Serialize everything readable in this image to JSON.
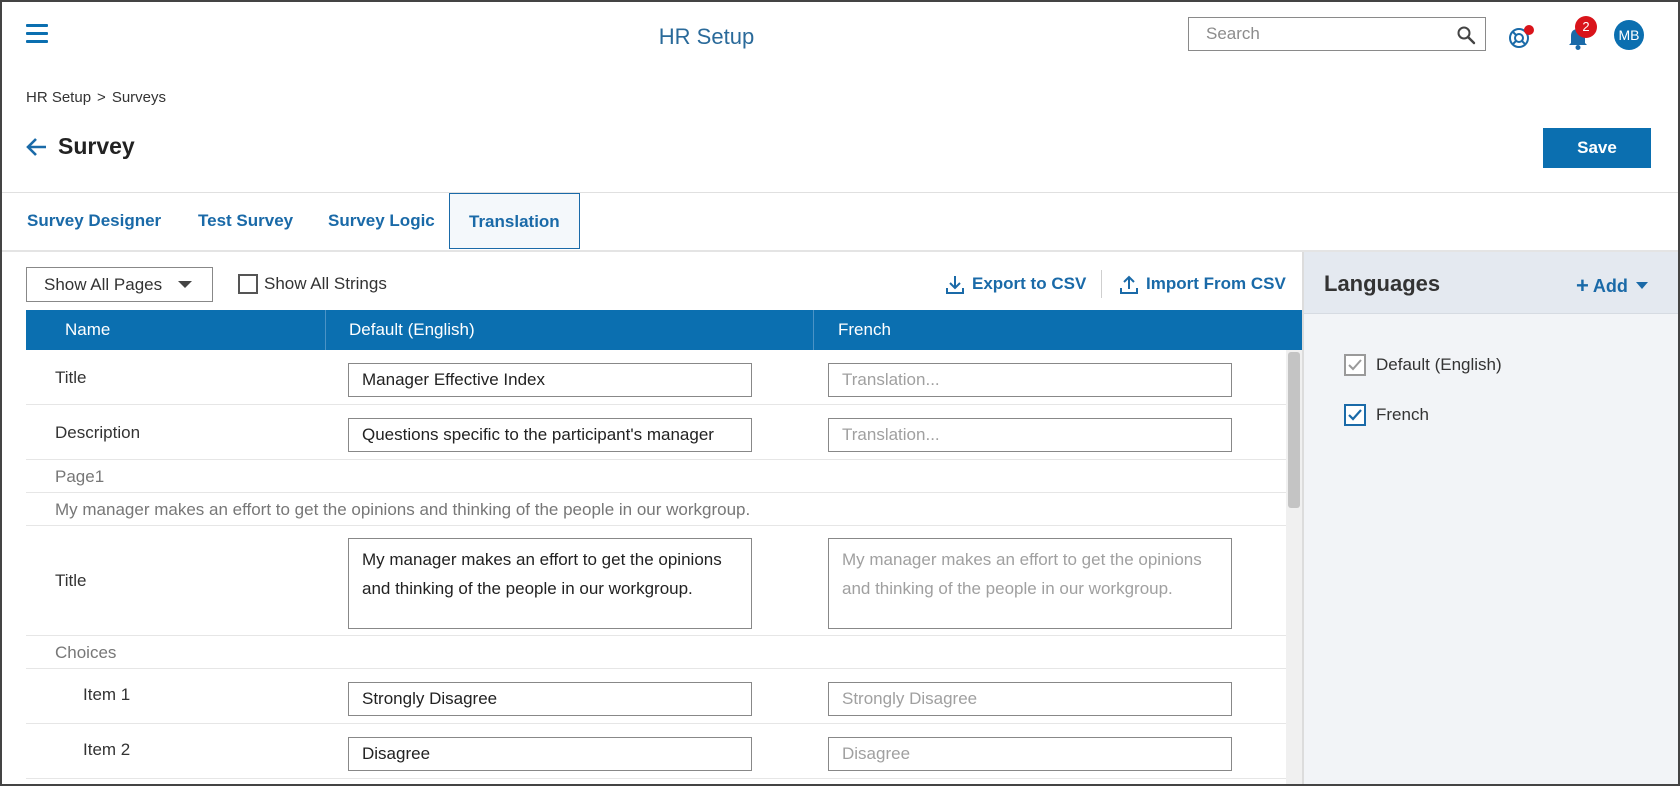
{
  "header": {
    "app_title": "HR Setup",
    "search_placeholder": "Search",
    "notification_count": "2",
    "avatar_initials": "MB"
  },
  "breadcrumb": {
    "items": [
      "HR Setup",
      "Surveys"
    ],
    "separator": ">"
  },
  "page": {
    "title": "Survey",
    "save_label": "Save"
  },
  "tabs": [
    {
      "label": "Survey Designer"
    },
    {
      "label": "Test Survey"
    },
    {
      "label": "Survey Logic"
    },
    {
      "label": "Translation",
      "active": true
    }
  ],
  "toolbar": {
    "page_filter": "Show All Pages",
    "show_all_strings_label": "Show All Strings",
    "export_label": "Export to CSV",
    "import_label": "Import From CSV"
  },
  "table": {
    "columns": [
      "Name",
      "Default (English)",
      "French"
    ],
    "rows": {
      "title": {
        "label": "Title",
        "default": "Manager Effective Index",
        "translation_placeholder": "Translation..."
      },
      "description": {
        "label": "Description",
        "default": "Questions specific to the participant's manager",
        "translation_placeholder": "Translation..."
      },
      "page_heading": "Page1",
      "question_heading": "My manager makes an effort to get the opinions and thinking of the people in our workgroup.",
      "question_title": {
        "label": "Title",
        "default": "My manager makes an effort to get the opinions and thinking of the people in our workgroup.",
        "translation_placeholder": "My manager makes an effort to get the opinions and thinking of the people in our workgroup."
      },
      "choices_heading": "Choices",
      "item1": {
        "label": "Item 1",
        "default": "Strongly Disagree",
        "translation_placeholder": "Strongly Disagree"
      },
      "item2": {
        "label": "Item 2",
        "default": "Disagree",
        "translation_placeholder": "Disagree"
      }
    }
  },
  "languages": {
    "title": "Languages",
    "add_label": "Add",
    "items": [
      {
        "label": "Default (English)",
        "checked": true,
        "disabled": true
      },
      {
        "label": "French",
        "checked": true,
        "disabled": false
      }
    ]
  },
  "colors": {
    "primary": "#0b6fb0",
    "badge": "#d9141b"
  }
}
